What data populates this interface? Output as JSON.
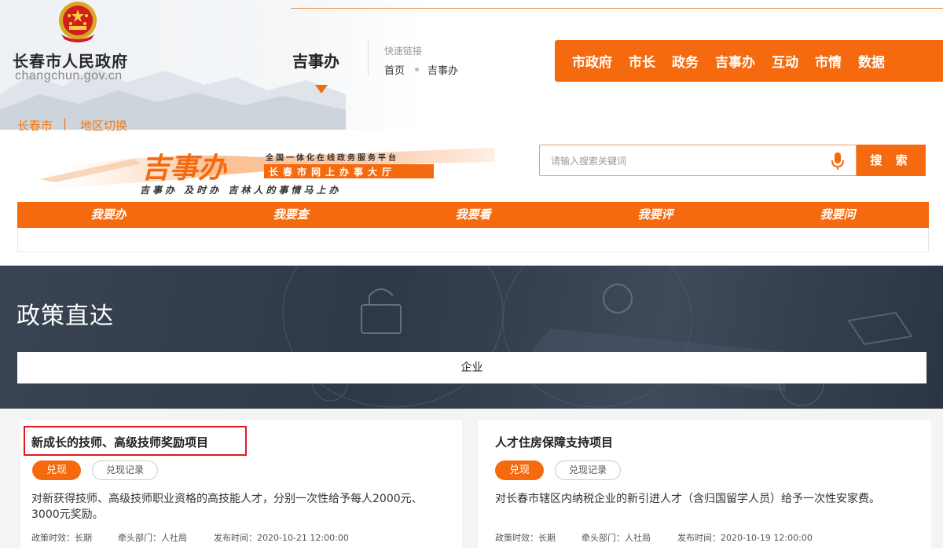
{
  "header": {
    "site_name": "长春市人民政府",
    "site_domain": "changchun.gov.cn",
    "region": "长春市",
    "region_separator": "|",
    "region_switch": "地区切换",
    "section_title": "吉事办",
    "quick_links_label": "快速链接",
    "breadcrumb": [
      "首页",
      "吉事办"
    ],
    "nav": [
      "市政府",
      "市长",
      "政务",
      "吉事办",
      "互动",
      "市情",
      "数据"
    ]
  },
  "banner": {
    "logo_text": "吉事办",
    "tagline_top": "全国一体化在线政务服务平台",
    "tagline_box": "长春市网上办事大厅",
    "slogan": "吉事办  及时办  吉林人的事情马上办"
  },
  "search": {
    "placeholder": "请输入搜索关键词",
    "button": "搜 索"
  },
  "tabs": [
    "我要办",
    "我要查",
    "我要看",
    "我要评",
    "我要问"
  ],
  "hero": {
    "title": "政策直达",
    "filter": "企业"
  },
  "cards": [
    {
      "title": "新成长的技师、高级技师奖励项目",
      "redeem": "兑现",
      "record": "兑现记录",
      "description": "对新获得技师、高级技师职业资格的高技能人才，分别一次性给予每人2000元、3000元奖励。",
      "validity": "政策时效：长期",
      "department": "牵头部门：人社局",
      "published": "发布时间：2020-10-21 12:00:00"
    },
    {
      "title": "人才住房保障支持项目",
      "redeem": "兑现",
      "record": "兑现记录",
      "description": "对长春市辖区内纳税企业的新引进人才（含归国留学人员）给予一次性安家费。",
      "validity": "政策时效：长期",
      "department": "牵头部门：人社局",
      "published": "发布时间：2020-10-19 12:00:00"
    }
  ],
  "colors": {
    "accent": "#f56a0f",
    "highlight": "#e1191f",
    "hero_bg": "#2e3846"
  },
  "icons": {
    "emblem": "national-emblem-icon",
    "mic": "microphone-icon"
  }
}
